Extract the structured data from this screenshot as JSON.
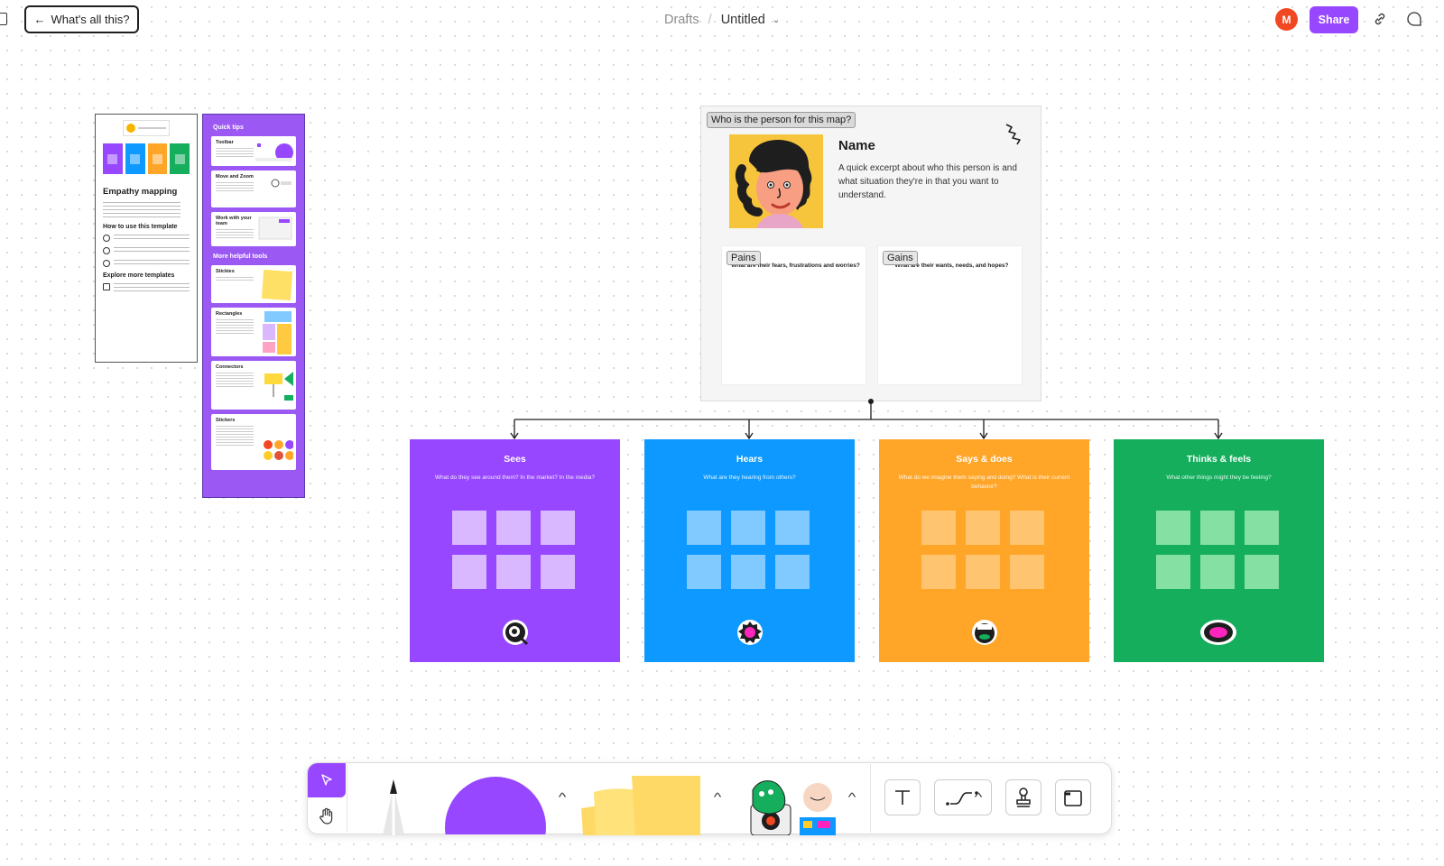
{
  "header": {
    "back_label": "What's all this?",
    "breadcrumb_parent": "Drafts",
    "breadcrumb_separator": "/",
    "file_title": "Untitled",
    "avatar_initial": "M",
    "share_label": "Share"
  },
  "guide": {
    "title": "Empathy mapping",
    "how_to": "How to use this template",
    "explore": "Explore more templates"
  },
  "tips": {
    "quick_tips": "Quick tips",
    "more_tools": "More helpful tools",
    "cards": [
      "Toolbar",
      "Move and Zoom",
      "Work with your team"
    ],
    "tools": [
      "Stickies",
      "Rectangles",
      "Connectors",
      "Stickers"
    ]
  },
  "persona": {
    "question": "Who is the person for this map?",
    "name": "Name",
    "description": "A quick excerpt about who this person is and what situation they're in that you want to understand.",
    "pains_label": "Pains",
    "pains_question": "What are their fears, frustrations and worries?",
    "gains_label": "Gains",
    "gains_question": "What are their wants, needs, and hopes?"
  },
  "quadrants": [
    {
      "title": "Sees",
      "question": "What do they see around them? In the market? In the media?",
      "color": "#9747ff",
      "sticky": "#d9b8ff"
    },
    {
      "title": "Hears",
      "question": "What are they hearing from others?",
      "color": "#0d99ff",
      "sticky": "#80caff"
    },
    {
      "title": "Says & does",
      "question": "What do we imagine them saying and doing? What is their current behavior?",
      "color": "#ffa629",
      "sticky": "#ffc470"
    },
    {
      "title": "Thinks & feels",
      "question": "What other things might they be feeling?",
      "color": "#14ae5c",
      "sticky": "#85e0a3"
    }
  ],
  "colors": {
    "accent": "#9747ff",
    "avatar": "#f24822"
  }
}
